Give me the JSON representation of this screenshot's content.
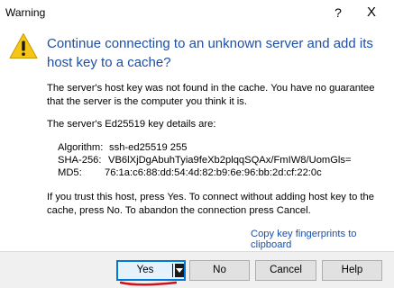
{
  "window": {
    "title": "Warning",
    "help_glyph": "?",
    "close_glyph": "X"
  },
  "icon": {
    "name": "warning-icon",
    "fill_color": "#f5c518",
    "glyph": "!"
  },
  "main_instruction": "Continue connecting to an unknown server and add its host key to a cache?",
  "paragraphs": {
    "not_found": "The server's host key was not found in the cache. You have no guarantee that the server is the computer you think it is.",
    "key_details_heading": "The server's Ed25519 key details are:",
    "instructions": "If you trust this host, press Yes. To connect without adding host key to the cache, press No. To abandon the connection press Cancel."
  },
  "key_details": [
    {
      "label": "Algorithm:",
      "value": "ssh-ed25519 255"
    },
    {
      "label": "SHA-256:",
      "value": "VB6lXjDgAbuhTyia9feXb2plqqSQAx/FmIW8/UomGls="
    },
    {
      "label": "MD5:",
      "value": "76:1a:c6:88:dd:54:4d:82:b9:6e:96:bb:2d:cf:22:0c"
    }
  ],
  "copy_link": "Copy key fingerprints to clipboard",
  "buttons": {
    "yes": "Yes",
    "no": "No",
    "cancel": "Cancel",
    "help": "Help"
  },
  "colors": {
    "instruction_blue": "#1e4fa6",
    "focus_border": "#0078d7",
    "annotation_red": "#d0101a"
  }
}
